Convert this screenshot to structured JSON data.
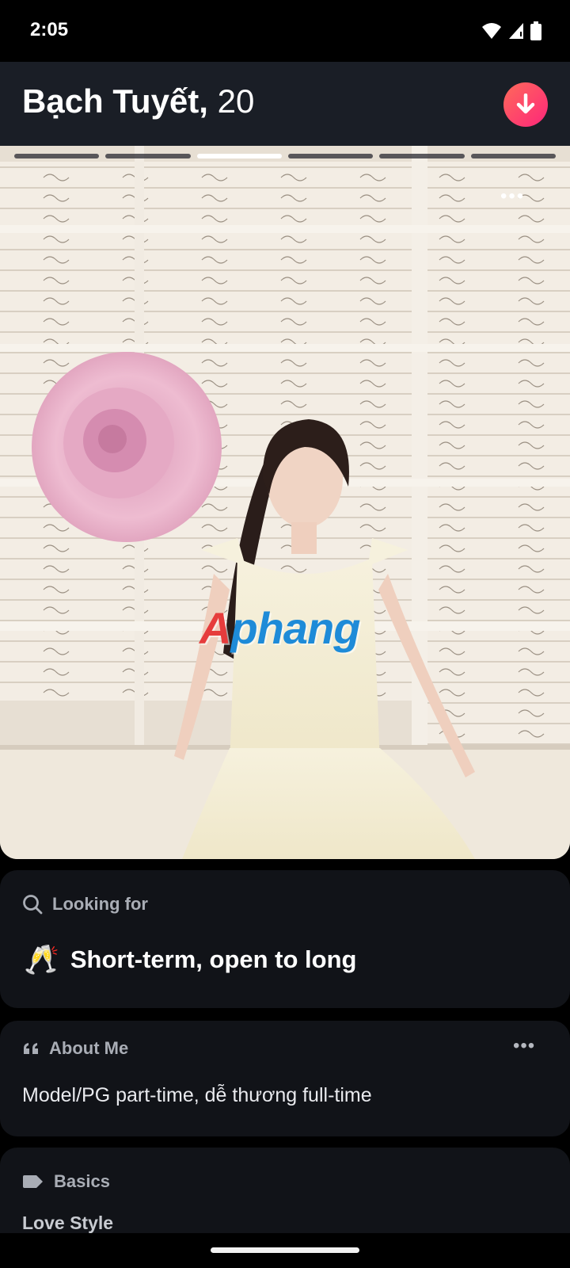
{
  "status_bar": {
    "time": "2:05",
    "icons": [
      "wifi-icon",
      "signal-icon",
      "battery-icon"
    ]
  },
  "profile": {
    "name": "Bạch Tuyết,",
    "age": "20"
  },
  "photo": {
    "total_photos": 6,
    "active_index": 2,
    "menu_label": "•••",
    "watermark": {
      "first_letter": "A",
      "rest": "phang"
    }
  },
  "looking_for": {
    "label": "Looking for",
    "emoji": "🥂",
    "value": "Short-term, open to long"
  },
  "about": {
    "label": "About Me",
    "text": "Model/PG part-time, dễ thương full-time",
    "menu_label": "•••"
  },
  "basics": {
    "label": "Basics",
    "sub_label": "Love Style"
  },
  "colors": {
    "accent_gradient_start": "#ff6a5a",
    "accent_gradient_end": "#fd267a",
    "card_bg": "#111318",
    "header_bg": "#1a1e26"
  }
}
